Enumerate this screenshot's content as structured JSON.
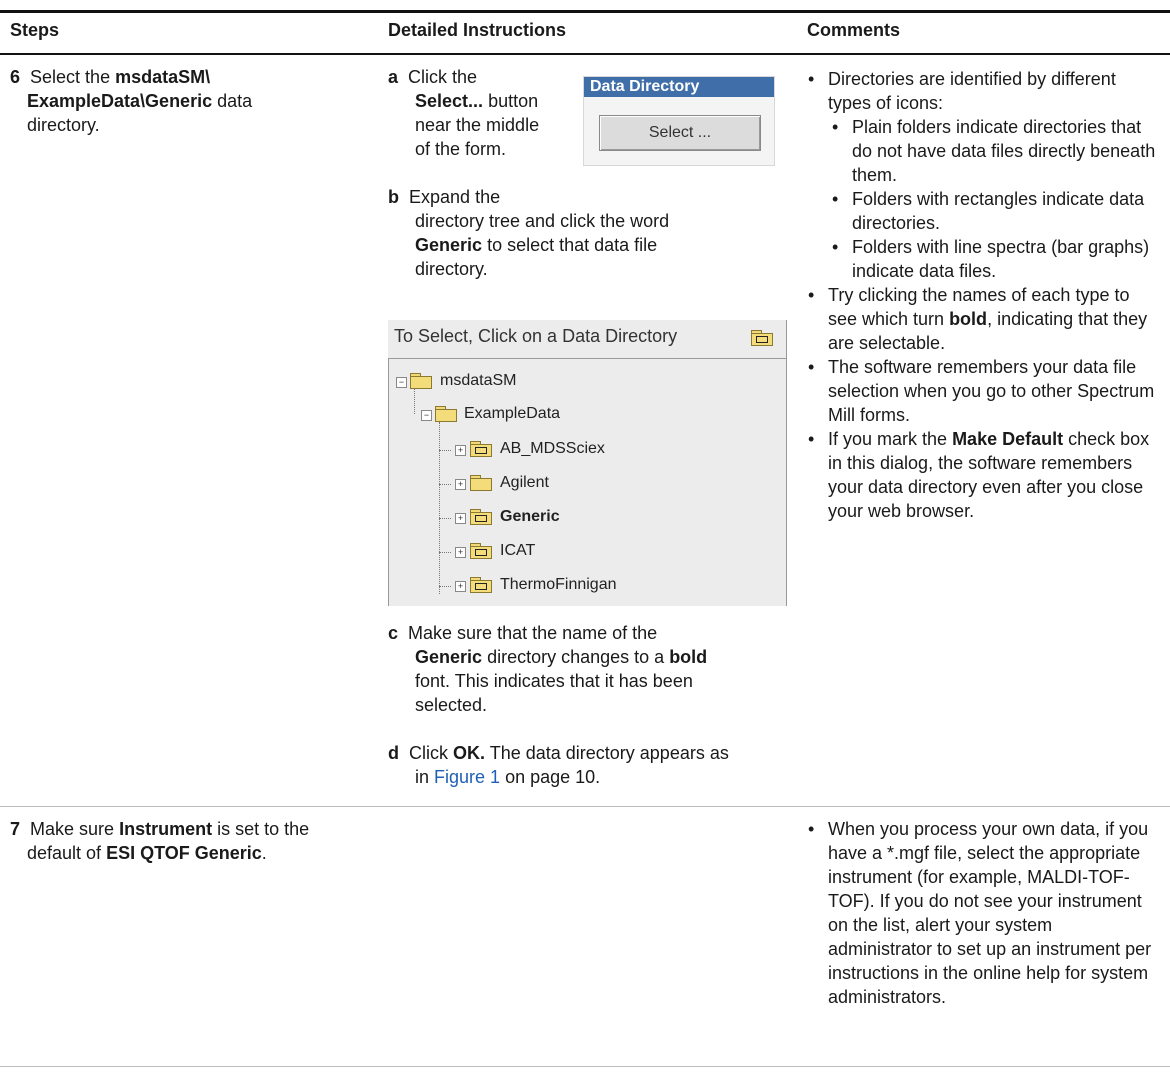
{
  "headers": {
    "steps": "Steps",
    "detailed": "Detailed Instructions",
    "comments": "Comments"
  },
  "row6": {
    "num": "6",
    "step_parts": [
      "Select the ",
      "msdataSM\\",
      "ExampleData\\Generic",
      " data",
      "directory."
    ],
    "a_letter": "a",
    "a_lines": [
      "Click the",
      "Select...",
      "button",
      "near the middle",
      "of the form."
    ],
    "b_letter": "b",
    "b_lines": [
      "Expand the",
      "directory tree and click the word",
      "Generic",
      "to select that data file",
      "directory."
    ],
    "c_letter": "c",
    "c_lines": [
      "Make sure that the name of the",
      "Generic",
      "directory changes to a",
      "bold",
      "font. This indicates that it has been",
      "selected."
    ],
    "d_letter": "d",
    "d_lines": [
      "Click ",
      "OK.",
      " The data directory appears as",
      "in ",
      "Figure 1",
      " on page 10."
    ],
    "widget": {
      "title": "Data Directory",
      "button": "Select ..."
    },
    "tree": {
      "header": "To Select, Click on a Data Directory",
      "root": "msdataSM",
      "child": "ExampleData",
      "items": [
        {
          "label": "AB_MDSSciex",
          "icon": "data-folder-icon",
          "bold": false
        },
        {
          "label": "Agilent",
          "icon": "plain-folder-icon",
          "bold": false
        },
        {
          "label": "Generic",
          "icon": "data-folder-icon",
          "bold": true
        },
        {
          "label": "ICAT",
          "icon": "data-folder-icon",
          "bold": false
        },
        {
          "label": "ThermoFinnigan",
          "icon": "data-folder-icon",
          "bold": false
        }
      ]
    },
    "comments": {
      "c1": "Directories are identified by different types of icons:",
      "sub": [
        "Plain folders indicate directories that do not have data files directly beneath them.",
        "Folders with rectangles indicate data directories.",
        "Folders with line spectra (bar graphs) indicate data files."
      ],
      "c2_pre": "Try clicking the names of each type to see which turn ",
      "c2_bold": "bold",
      "c2_post": ", indicating that they are selectable.",
      "c3": "The software remembers your data file selection when you go to other Spectrum Mill forms.",
      "c4_pre": "If you mark the ",
      "c4_bold": "Make Default",
      "c4_post": " check box in this dialog, the software remembers your data directory even after you close your web browser."
    }
  },
  "row7": {
    "num": "7",
    "step_pre": "Make sure ",
    "step_b1": "Instrument",
    "step_mid": " is set to the",
    "step_line2_pre": "default of ",
    "step_b2": "ESI QTOF Generic",
    "step_line2_post": ".",
    "comment": "When you process your own data, if you have a *.mgf file, select the appropriate instrument (for example, MALDI-TOF-TOF). If you do not see your instrument on the list, alert your system administrator to set up an instrument per instructions in the online help for system administrators."
  },
  "colors": {
    "link": "#1f5fb4",
    "widget_title": "#3f6ea8"
  }
}
